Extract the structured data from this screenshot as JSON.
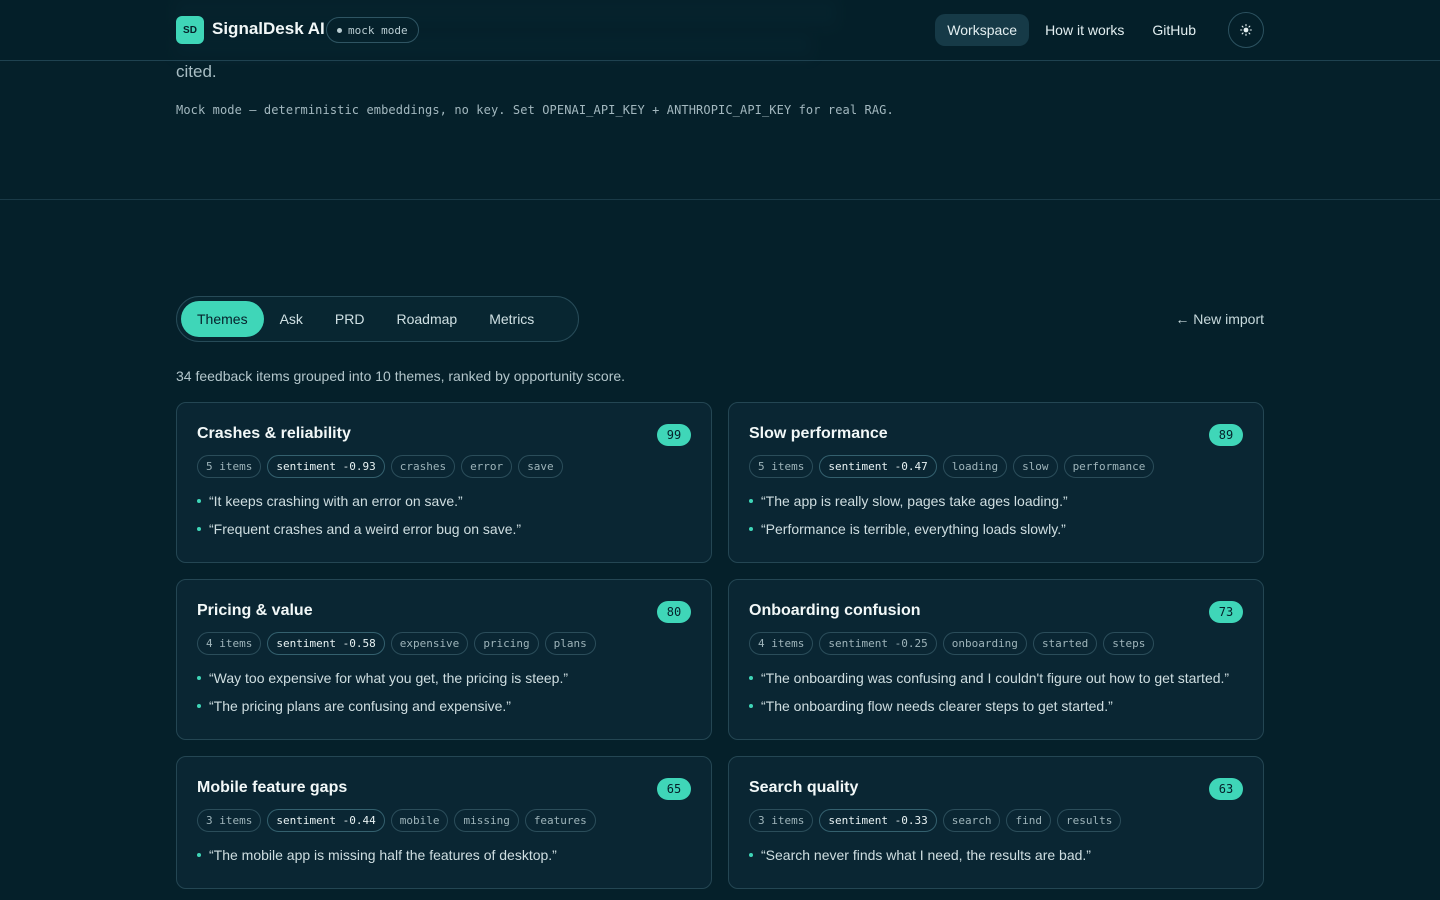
{
  "hero": {
    "cited_text": "cited.",
    "mode_note": "Mock mode — deterministic embeddings, no key. Set OPENAI_API_KEY + ANTHROPIC_API_KEY for real RAG."
  },
  "header": {
    "logo_text": "SD",
    "app_title": "SignalDesk AI",
    "mode_badge": "mock mode",
    "nav": [
      "Workspace",
      "How it works",
      "GitHub"
    ],
    "theme_icon": "sun-icon"
  },
  "tabs": [
    "Themes",
    "Ask",
    "PRD",
    "Roadmap",
    "Metrics"
  ],
  "new_import": "← New import",
  "summary": "34 feedback items grouped into 10 themes, ranked by opportunity score.",
  "colors": {
    "accent": "#3fd6b8",
    "background": "#05202a",
    "card": "#0a2633"
  },
  "themes": [
    {
      "title": "Crashes & reliability",
      "score": "99",
      "items": "5 items",
      "sentiment": "sentiment -0.93",
      "keywords": [
        "crashes",
        "error",
        "save"
      ],
      "quotes": [
        "“It keeps crashing with an error on save.”",
        "“Frequent crashes and a weird error bug on save.”"
      ]
    },
    {
      "title": "Slow performance",
      "score": "89",
      "items": "5 items",
      "sentiment": "sentiment -0.47",
      "keywords": [
        "loading",
        "slow",
        "performance"
      ],
      "quotes": [
        "“The app is really slow, pages take ages loading.”",
        "“Performance is terrible, everything loads slowly.”"
      ]
    },
    {
      "title": "Pricing & value",
      "score": "80",
      "items": "4 items",
      "sentiment": "sentiment -0.58",
      "keywords": [
        "expensive",
        "pricing",
        "plans"
      ],
      "quotes": [
        "“Way too expensive for what you get, the pricing is steep.”",
        "“The pricing plans are confusing and expensive.”"
      ]
    },
    {
      "title": "Onboarding confusion",
      "score": "73",
      "items": "4 items",
      "sentiment": "sentiment -0.25",
      "keywords": [
        "onboarding",
        "started",
        "steps"
      ],
      "quotes": [
        "“The onboarding was confusing and I couldn't figure out how to get started.”",
        "“The onboarding flow needs clearer steps to get started.”"
      ]
    },
    {
      "title": "Mobile feature gaps",
      "score": "65",
      "items": "3 items",
      "sentiment": "sentiment -0.44",
      "keywords": [
        "mobile",
        "missing",
        "features"
      ],
      "quotes": [
        "“The mobile app is missing half the features of desktop.”"
      ]
    },
    {
      "title": "Search quality",
      "score": "63",
      "items": "3 items",
      "sentiment": "sentiment -0.33",
      "keywords": [
        "search",
        "find",
        "results"
      ],
      "quotes": [
        "“Search never finds what I need, the results are bad.”"
      ]
    }
  ]
}
